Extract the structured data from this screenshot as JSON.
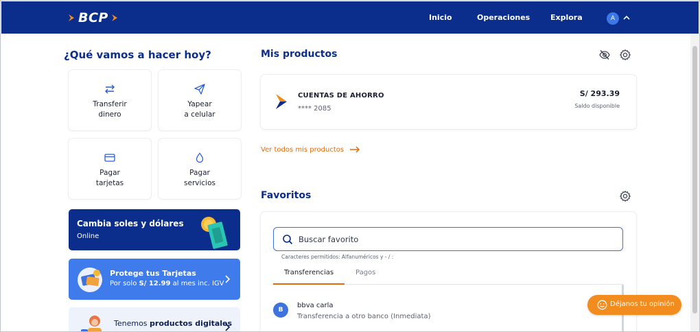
{
  "header": {
    "logo_text": "BCP",
    "nav": [
      "Inicio",
      "Operaciones",
      "Explora"
    ],
    "avatar_initial": "A"
  },
  "left": {
    "heading": "¿Qué vamos a hacer hoy?",
    "tiles": [
      {
        "label": "Transferir\ndinero",
        "icon": "transfer-arrows-icon"
      },
      {
        "label": "Yapear\na celular",
        "icon": "send-plane-icon"
      },
      {
        "label": "Pagar\ntarjetas",
        "icon": "credit-card-icon"
      },
      {
        "label": "Pagar\nservicios",
        "icon": "water-drop-icon"
      }
    ],
    "promo_exchange": {
      "title": "Cambia soles y dólares",
      "subtitle": "Online"
    },
    "promo_cards": {
      "title": "Protege tus Tarjetas",
      "subtitle_pre": "Por solo ",
      "subtitle_bold": "S/ 12.99",
      "subtitle_post": " al mes inc. IGV"
    },
    "promo_digital": {
      "text_pre": "Tenemos ",
      "text_bold": "productos digitales"
    }
  },
  "products": {
    "heading": "Mis productos",
    "account": {
      "name": "CUENTAS DE AHORRO",
      "number": "**** 2085",
      "amount": "S/ 293.39",
      "amount_label": "Saldo disponible"
    },
    "see_all": "Ver todos mis productos"
  },
  "favorites": {
    "heading": "Favoritos",
    "search_placeholder": "Buscar favorito",
    "hint": "Caracteres permitidos: Alfanuméricos y - / :",
    "tabs": [
      "Transferencias",
      "Pagos"
    ],
    "items": [
      {
        "initial": "B",
        "name": "bbva carla",
        "desc": "Transferencia a otro banco (Inmediata)"
      }
    ]
  },
  "feedback_label": "Déjanos tu opinión",
  "colors": {
    "brand_blue": "#0b2e8c",
    "accent_orange": "#e46b0b",
    "link_blue": "#3f7bea"
  }
}
